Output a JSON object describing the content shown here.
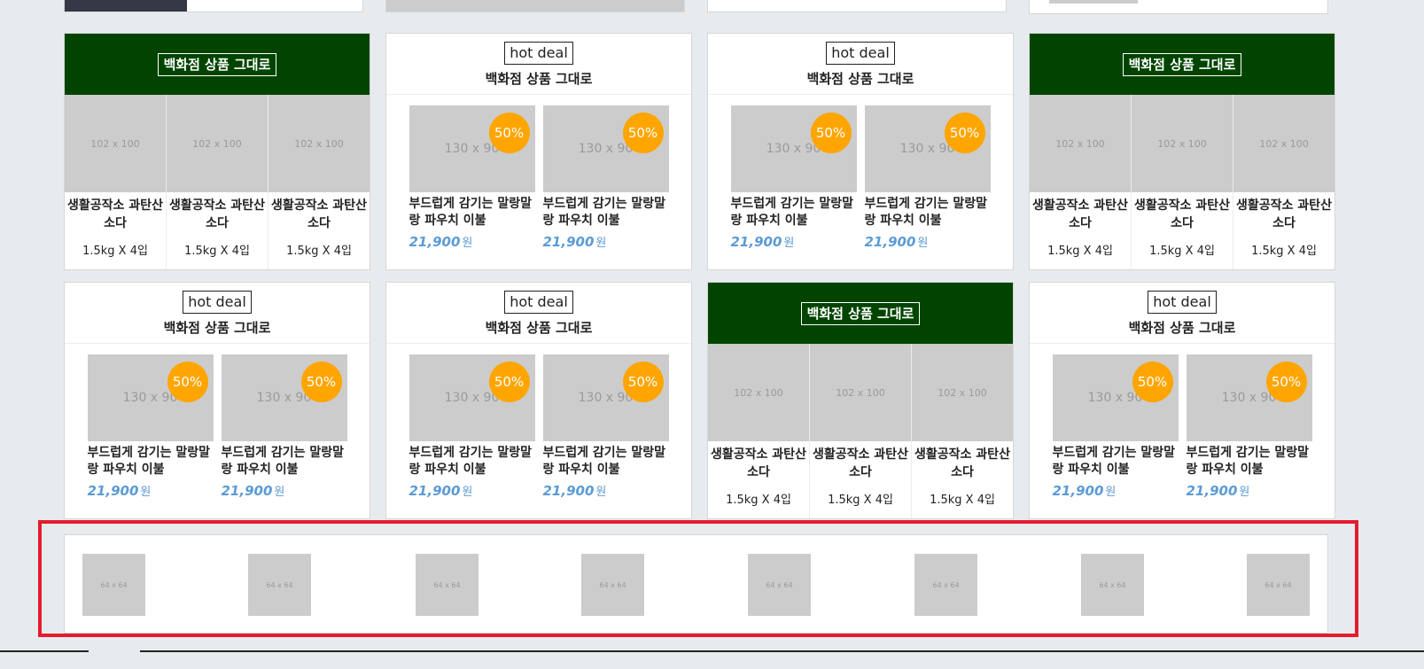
{
  "hot_deal_label": "hot deal",
  "department_label": "백화점 상품 그대로",
  "three_items": [
    {
      "placeholder": "102 x 100",
      "name": "생활공작소 과탄산소다",
      "spec": "1.5kg X 4입"
    },
    {
      "placeholder": "102 x 100",
      "name": "생활공작소 과탄산소다",
      "spec": "1.5kg X 4입"
    },
    {
      "placeholder": "102 x 100",
      "name": "생활공작소 과탄산소다",
      "spec": "1.5kg X 4입"
    }
  ],
  "deal_items": [
    {
      "placeholder": "130 x 90",
      "badge": "50%",
      "name": "부드럽게 감기는 말랑말랑 파우치 이불",
      "price": "21,900",
      "unit": "원"
    },
    {
      "placeholder": "130 x 90",
      "badge": "50%",
      "name": "부드럽게 감기는 말랑말랑 파우치 이불",
      "price": "21,900",
      "unit": "원"
    }
  ],
  "icon_strip": {
    "placeholder": "64 x 64",
    "items": [
      "64 x 64",
      "64 x 64",
      "64 x 64",
      "64 x 64",
      "64 x 64",
      "64 x 64",
      "64 x 64",
      "64 x 64"
    ]
  },
  "colors": {
    "background": "#e8ebee",
    "green_header": "#004400",
    "badge": "#ffa500",
    "price": "#5b9bd5",
    "highlight_outline": "#e21d2d",
    "placeholder": "#cccccc"
  }
}
